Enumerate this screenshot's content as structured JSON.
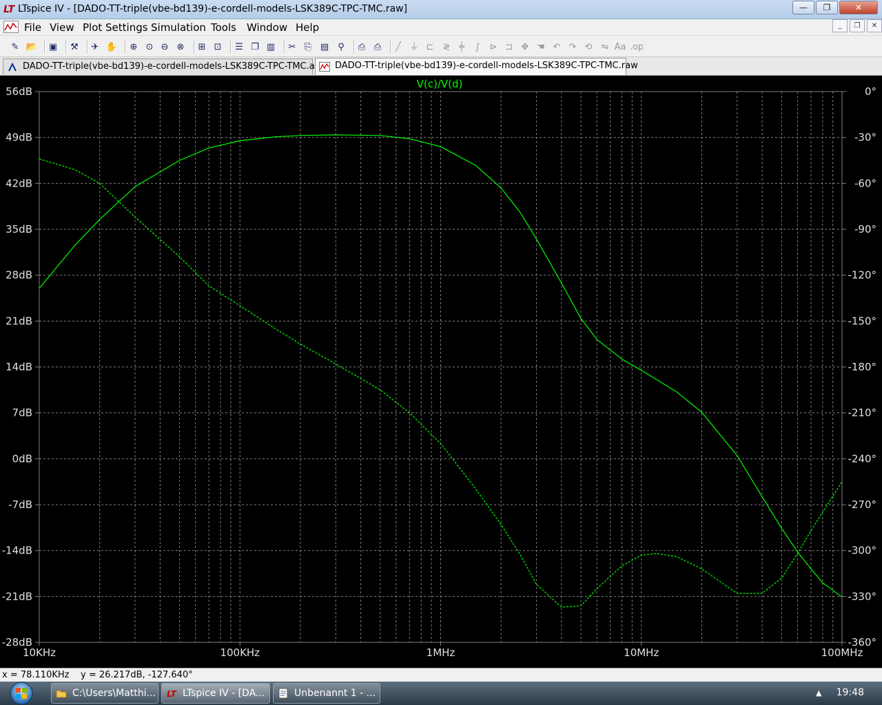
{
  "window": {
    "title": "LTspice IV - [DADO-TT-triple(vbe-bd139)-e-cordell-models-LSK389C-TPC-TMC.raw]"
  },
  "menu": [
    "File",
    "View",
    "Plot Settings",
    "Simulation",
    "Tools",
    "Window",
    "Help"
  ],
  "toolbar": [
    "new-schematic-icon",
    "open-icon",
    "save-icon",
    "control-panel-icon",
    "run-icon",
    "halt-icon",
    "zoom-in-icon",
    "zoom-rect-icon",
    "zoom-out-icon",
    "zoom-cancel-icon",
    "autorange-icon",
    "mark-icon",
    "tile-horizontal-icon",
    "cascade-icon",
    "tile-vertical-icon",
    "cut-icon",
    "copy-icon",
    "paste-icon",
    "find-icon",
    "print-setup-icon",
    "print-icon",
    "wire-icon",
    "ground-icon",
    "label-icon",
    "resistor-icon",
    "capacitor-icon",
    "inductor-icon",
    "diode-icon",
    "component-icon",
    "move-icon",
    "drag-icon",
    "undo-icon",
    "redo-icon",
    "rotate-icon",
    "mirror-icon",
    "text-icon",
    "spice-directive-icon"
  ],
  "tabs": [
    {
      "label": "DADO-TT-triple(vbe-bd139)-e-cordell-models-LSK389C-TPC-TMC.asc",
      "icon": "schematic-icon"
    },
    {
      "label": "DADO-TT-triple(vbe-bd139)-e-cordell-models-LSK389C-TPC-TMC.raw",
      "icon": "waveform-icon"
    }
  ],
  "status": "x = 78.110KHz    y = 26.217dB, -127.640°",
  "taskbar": {
    "items": [
      "C:\\Users\\Matthi...",
      "LTspice IV - [DA...",
      "Unbenannt 1 - ..."
    ],
    "clock": "19:48"
  },
  "colors": {
    "trace": "#00ff00",
    "grid": "#7f7f7f",
    "axis_text": "#e0e0e0",
    "background": "#000000"
  },
  "chart_data": {
    "type": "line",
    "title": "V(c)/V(d)",
    "x_scale": "log",
    "xlim": [
      10000,
      100000000
    ],
    "xticks": [
      10000,
      100000,
      1000000,
      10000000,
      100000000
    ],
    "xtick_labels": [
      "10KHz",
      "100KHz",
      "1MHz",
      "10MHz",
      "100MHz"
    ],
    "ylim_left": [
      -28,
      56
    ],
    "yticks_left": [
      56,
      49,
      42,
      35,
      28,
      21,
      14,
      7,
      0,
      -7,
      -14,
      -21,
      -28
    ],
    "ytick_labels_left": [
      "56dB",
      "49dB",
      "42dB",
      "35dB",
      "28dB",
      "21dB",
      "14dB",
      "7dB",
      "0dB",
      "-7dB",
      "-14dB",
      "-21dB",
      "-28dB"
    ],
    "ylim_right": [
      -360,
      0
    ],
    "yticks_right": [
      0,
      -30,
      -60,
      -90,
      -120,
      -150,
      -180,
      -210,
      -240,
      -270,
      -300,
      -330,
      -360
    ],
    "ytick_labels_right": [
      "0°",
      "-30°",
      "-60°",
      "-90°",
      "-120°",
      "-150°",
      "-180°",
      "-210°",
      "-240°",
      "-270°",
      "-300°",
      "-330°",
      "-360°"
    ],
    "grid": true,
    "series": [
      {
        "style": "solid",
        "axis": "left",
        "x": [
          10000,
          15000,
          20000,
          30000,
          50000,
          70000,
          100000,
          150000,
          200000,
          300000,
          500000,
          700000,
          1000000,
          1500000,
          2000000,
          2500000,
          3000000,
          4000000,
          5000000,
          6000000,
          8000000,
          10000000,
          15000000,
          20000000,
          30000000,
          40000000,
          50000000,
          60000000,
          70000000,
          80000000,
          100000000
        ],
        "y": [
          26,
          32.5,
          36.5,
          41.5,
          45.5,
          47.4,
          48.5,
          49.1,
          49.3,
          49.4,
          49.3,
          48.8,
          47.6,
          44.7,
          41.3,
          37.5,
          33.5,
          26.8,
          21.4,
          18.2,
          15.2,
          13.5,
          10.2,
          7.1,
          0.5,
          -5.8,
          -10.6,
          -14.2,
          -16.8,
          -18.9,
          -21.1
        ]
      },
      {
        "style": "dashed",
        "axis": "right",
        "x": [
          10000,
          15000,
          20000,
          30000,
          50000,
          70000,
          100000,
          150000,
          200000,
          300000,
          500000,
          700000,
          1000000,
          1500000,
          2000000,
          2500000,
          3000000,
          4000000,
          5000000,
          6000000,
          8000000,
          10000000,
          12000000,
          15000000,
          20000000,
          30000000,
          40000000,
          50000000,
          60000000,
          70000000,
          80000000,
          100000000
        ],
        "y": [
          -44,
          -51,
          -60,
          -82,
          -108,
          -127,
          -140,
          -155,
          -165,
          -178,
          -195,
          -210,
          -230,
          -260,
          -283,
          -303,
          -322,
          -337,
          -336,
          -325,
          -310,
          -303,
          -302,
          -304,
          -312,
          -328,
          -328,
          -318,
          -302,
          -287,
          -275,
          -255
        ]
      }
    ]
  }
}
